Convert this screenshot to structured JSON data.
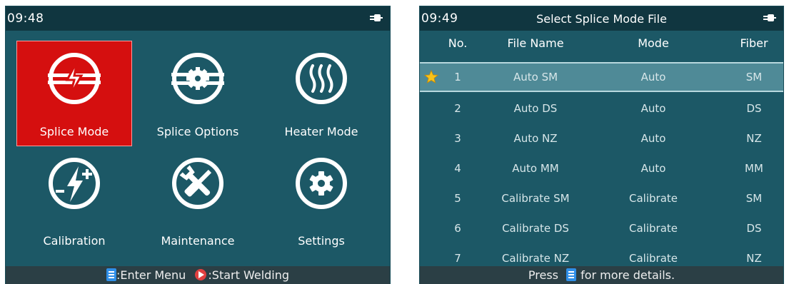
{
  "left_screen": {
    "status_time": "09:48",
    "menu_items": [
      {
        "label": "Splice Mode",
        "icon": "splice-icon",
        "selected": true
      },
      {
        "label": "Splice Options",
        "icon": "splice-options-icon",
        "selected": false
      },
      {
        "label": "Heater Mode",
        "icon": "heater-icon",
        "selected": false
      },
      {
        "label": "Calibration",
        "icon": "calibration-icon",
        "selected": false
      },
      {
        "label": "Maintenance",
        "icon": "wrench-screwdriver-icon",
        "selected": false
      },
      {
        "label": "Settings",
        "icon": "gear-icon",
        "selected": false
      }
    ],
    "footer": {
      "enter_label": ":Enter Menu",
      "start_label": ":Start Welding"
    }
  },
  "right_screen": {
    "status_time": "09:49",
    "title": "Select Splice Mode File",
    "columns": [
      "No.",
      "File Name",
      "Mode",
      "Fiber"
    ],
    "rows": [
      {
        "no": "1",
        "name": "Auto SM",
        "mode": "Auto",
        "fiber": "SM",
        "selected": true,
        "starred": true
      },
      {
        "no": "2",
        "name": "Auto DS",
        "mode": "Auto",
        "fiber": "DS"
      },
      {
        "no": "3",
        "name": "Auto NZ",
        "mode": "Auto",
        "fiber": "NZ"
      },
      {
        "no": "4",
        "name": "Auto MM",
        "mode": "Auto",
        "fiber": "MM"
      },
      {
        "no": "5",
        "name": "Calibrate SM",
        "mode": "Calibrate",
        "fiber": "SM"
      },
      {
        "no": "6",
        "name": "Calibrate DS",
        "mode": "Calibrate",
        "fiber": "DS"
      },
      {
        "no": "7",
        "name": "Calibrate NZ",
        "mode": "Calibrate",
        "fiber": "NZ"
      }
    ],
    "footer": {
      "press_label": "Press",
      "details_label": "for more details."
    }
  },
  "colors": {
    "screen_bg": "#1c5866",
    "statusbar_bg": "#103640",
    "footer_bg": "#2b3f45",
    "selected_menu_bg": "#d50f0f",
    "selected_row_bg": "#4f8a97",
    "icon_blue": "#2f8fe8",
    "play_red": "#e04040"
  }
}
